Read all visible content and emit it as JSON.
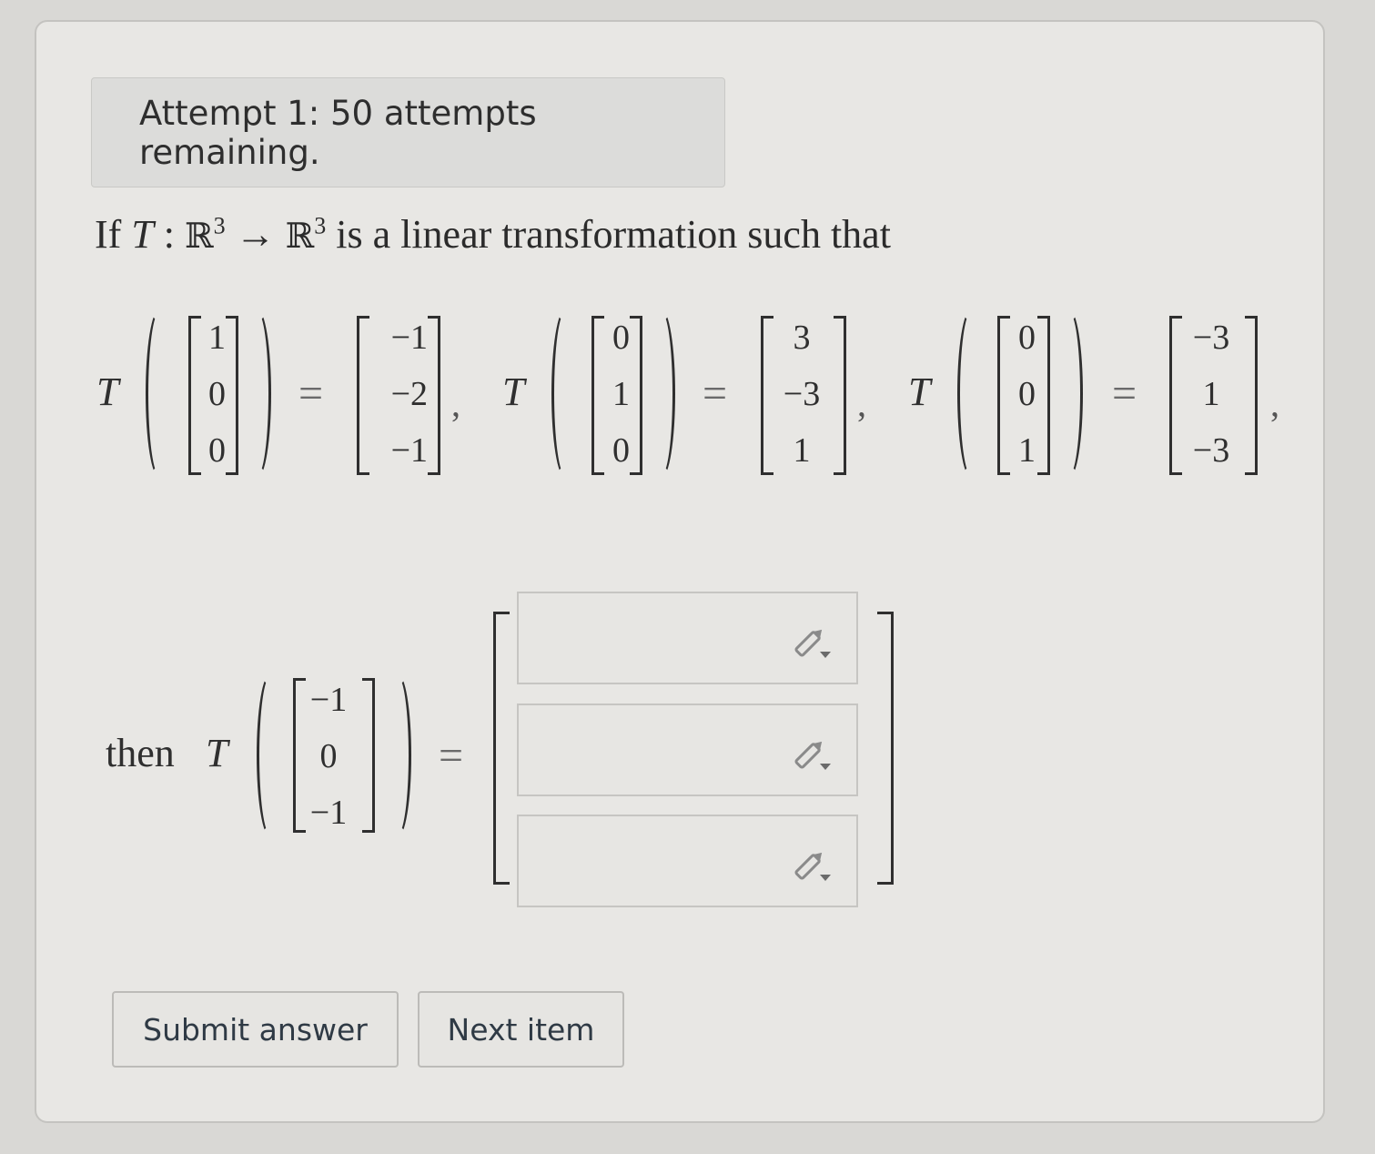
{
  "attempt_banner": "Attempt 1: 50 attempts remaining.",
  "question": {
    "if": "If",
    "T": "T",
    "colon": ":",
    "domain": "ℝ",
    "domain_exp": "3",
    "arrow": "→",
    "codomain": "ℝ",
    "codomain_exp": "3",
    "rest": "is a linear transformation such that"
  },
  "mappings": [
    {
      "input": [
        "1",
        "0",
        "0"
      ],
      "output": [
        "−1",
        "−2",
        "−1"
      ]
    },
    {
      "input": [
        "0",
        "1",
        "0"
      ],
      "output": [
        "3",
        "−3",
        "1"
      ]
    },
    {
      "input": [
        "0",
        "0",
        "1"
      ],
      "output": [
        "−3",
        "1",
        "−3"
      ]
    }
  ],
  "symbols": {
    "T": "T",
    "equals": "=",
    "comma": ","
  },
  "query": {
    "then": "then",
    "T": "T",
    "input": [
      "−1",
      "0",
      "−1"
    ],
    "equals": "="
  },
  "answer_fields": [
    {
      "value": "",
      "icon": "pencil-dropdown-icon"
    },
    {
      "value": "",
      "icon": "pencil-dropdown-icon"
    },
    {
      "value": "",
      "icon": "pencil-dropdown-icon"
    }
  ],
  "buttons": {
    "submit": "Submit answer",
    "next": "Next item"
  },
  "colors": {
    "page_bg": "#d9d8d5",
    "card_bg": "#e8e7e4",
    "banner_bg": "#dcdcda",
    "button_text": "#2f3a45"
  }
}
